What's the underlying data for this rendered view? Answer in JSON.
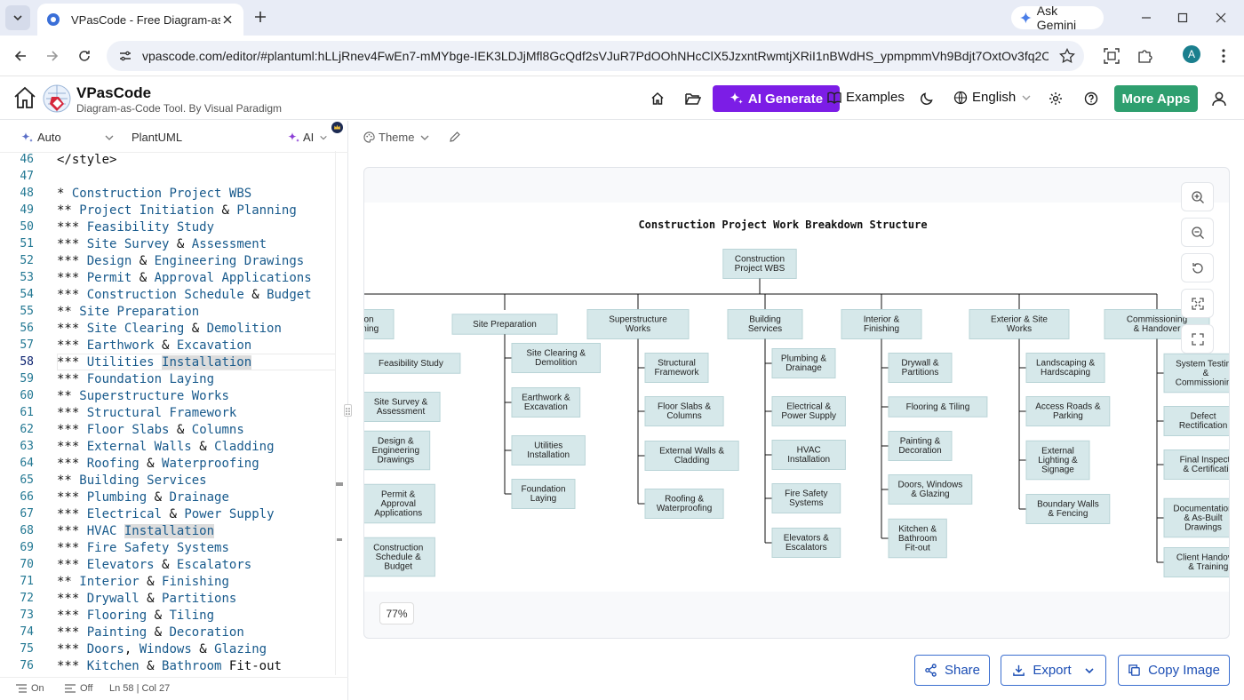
{
  "browser": {
    "tab_title": "VPasCode - Free Diagram-as-Co",
    "url": "vpascode.com/editor/#plantuml:hLLjRnev4FwEn7-mMYbge-IEK3LDJjMfl8GcQdf2sVJuR7PdOOhNHcClX5JzxntRwmtjXRiI1nBWdHS_ypmpmmVh9Bdjt7OxtOv3fq2CZB...",
    "gemini_label": "Ask Gemini",
    "profile_initial": "A"
  },
  "app": {
    "name": "VPasCode",
    "subtitle": "Diagram-as-Code Tool. By Visual Paradigm",
    "ai_generate": "AI Generate",
    "examples": "Examples",
    "language": "English",
    "more_apps": "More Apps"
  },
  "editor": {
    "mode": "Auto",
    "language": "PlantUML",
    "ai": "AI",
    "status": {
      "wrap": "On",
      "format": "Off",
      "position": "Ln 58 | Col 27"
    }
  },
  "code_lines": [
    {
      "n": "46",
      "stars": "",
      "text": "</style>"
    },
    {
      "n": "47",
      "stars": "",
      "text": ""
    },
    {
      "n": "48",
      "stars": "*",
      "text": "Construction Project WBS"
    },
    {
      "n": "49",
      "stars": "**",
      "text": "Project Initiation & Planning"
    },
    {
      "n": "50",
      "stars": "***",
      "text": "Feasibility Study"
    },
    {
      "n": "51",
      "stars": "***",
      "text": "Site Survey & Assessment"
    },
    {
      "n": "52",
      "stars": "***",
      "text": "Design & Engineering Drawings"
    },
    {
      "n": "53",
      "stars": "***",
      "text": "Permit & Approval Applications"
    },
    {
      "n": "54",
      "stars": "***",
      "text": "Construction Schedule & Budget"
    },
    {
      "n": "55",
      "stars": "**",
      "text": "Site Preparation"
    },
    {
      "n": "56",
      "stars": "***",
      "text": "Site Clearing & Demolition"
    },
    {
      "n": "57",
      "stars": "***",
      "text": "Earthwork & Excavation"
    },
    {
      "n": "58",
      "stars": "***",
      "text": "Utilities Installation"
    },
    {
      "n": "59",
      "stars": "***",
      "text": "Foundation Laying"
    },
    {
      "n": "60",
      "stars": "**",
      "text": "Superstructure Works"
    },
    {
      "n": "61",
      "stars": "***",
      "text": "Structural Framework"
    },
    {
      "n": "62",
      "stars": "***",
      "text": "Floor Slabs & Columns"
    },
    {
      "n": "63",
      "stars": "***",
      "text": "External Walls & Cladding"
    },
    {
      "n": "64",
      "stars": "***",
      "text": "Roofing & Waterproofing"
    },
    {
      "n": "65",
      "stars": "**",
      "text": "Building Services"
    },
    {
      "n": "66",
      "stars": "***",
      "text": "Plumbing & Drainage"
    },
    {
      "n": "67",
      "stars": "***",
      "text": "Electrical & Power Supply"
    },
    {
      "n": "68",
      "stars": "***",
      "text": "HVAC Installation"
    },
    {
      "n": "69",
      "stars": "***",
      "text": "Fire Safety Systems"
    },
    {
      "n": "70",
      "stars": "***",
      "text": "Elevators & Escalators"
    },
    {
      "n": "71",
      "stars": "**",
      "text": "Interior & Finishing"
    },
    {
      "n": "72",
      "stars": "***",
      "text": "Drywall & Partitions"
    },
    {
      "n": "73",
      "stars": "***",
      "text": "Flooring & Tiling"
    },
    {
      "n": "74",
      "stars": "***",
      "text": "Painting & Decoration"
    },
    {
      "n": "75",
      "stars": "***",
      "text": "Doors, Windows & Glazing"
    },
    {
      "n": "76",
      "stars": "***",
      "text": "Kitchen & Bathroom Fit-out"
    }
  ],
  "preview": {
    "theme_label": "Theme",
    "zoom": "77%",
    "share": "Share",
    "export": "Export",
    "copy_image": "Copy Image"
  },
  "diagram": {
    "title": "Construction Project Work Breakdown Structure",
    "root": "Construction\nProject WBS",
    "branches": [
      {
        "label": "Initiation\n& Planning",
        "children": [
          "Feasibility Study",
          "Site Survey &\nAssessment",
          "Design &\nEngineering\nDrawings",
          "Permit &\nApproval\nApplications",
          "Construction\nSchedule &\nBudget"
        ]
      },
      {
        "label": "Site Preparation",
        "children": [
          "Site Clearing &\nDemolition",
          "Earthwork &\nExcavation",
          "Utilities\nInstallation",
          "Foundation\nLaying"
        ]
      },
      {
        "label": "Superstructure\nWorks",
        "children": [
          "Structural\nFramework",
          "Floor Slabs &\nColumns",
          "External Walls &\nCladding",
          "Roofing &\nWaterproofing"
        ]
      },
      {
        "label": "Building\nServices",
        "children": [
          "Plumbing &\nDrainage",
          "Electrical &\nPower Supply",
          "HVAC\nInstallation",
          "Fire Safety\nSystems",
          "Elevators &\nEscalators"
        ]
      },
      {
        "label": "Interior &\nFinishing",
        "children": [
          "Drywall &\nPartitions",
          "Flooring & Tiling",
          "Painting &\nDecoration",
          "Doors, Windows\n& Glazing",
          "Kitchen &\nBathroom\nFit-out"
        ]
      },
      {
        "label": "Exterior & Site\nWorks",
        "children": [
          "Landscaping &\nHardscaping",
          "Access Roads &\nParking",
          "External\nLighting &\nSignage",
          "Boundary Walls\n& Fencing"
        ]
      },
      {
        "label": "Commissioning\n& Handover",
        "children": [
          "System Testing\n&\nCommissioning",
          "Defect\nRectification",
          "Final Inspection\n& Certification",
          "Documentation\n& As-Built\nDrawings",
          "Client Handover\n& Training"
        ]
      }
    ]
  },
  "colors": {
    "accent_purple": "#7c1de6",
    "accent_green": "#2e9f6f",
    "node_fill": "#d6e8ea",
    "node_stroke": "#b9d4d7"
  }
}
